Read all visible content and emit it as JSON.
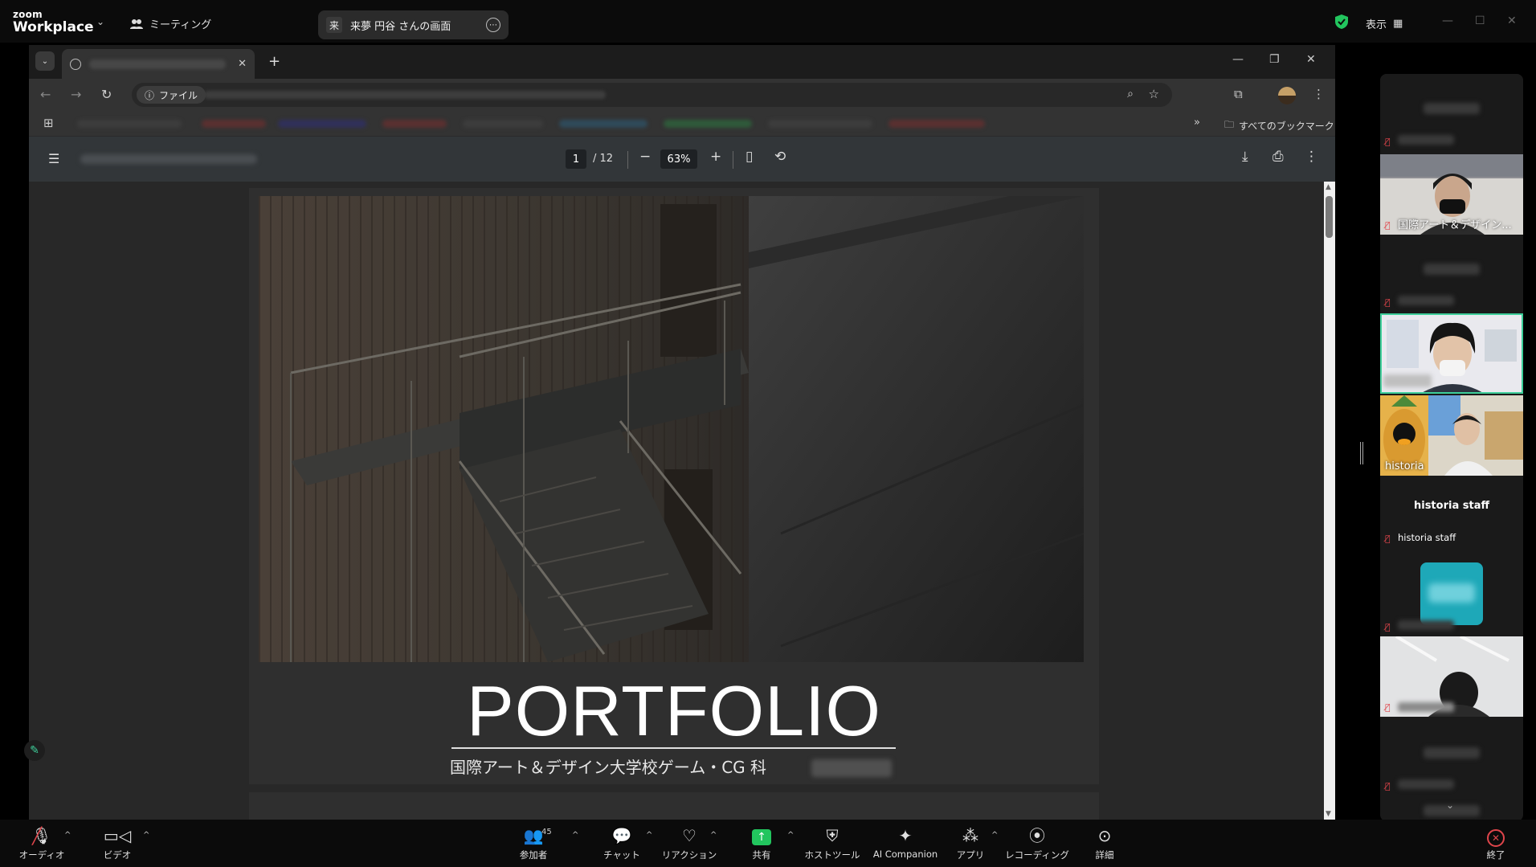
{
  "zoom": {
    "logo_small": "zoom",
    "logo_big": "Workplace",
    "meeting_label": "ミーティング",
    "share_badge": "来",
    "share_title": "来夢 円谷 さんの画面",
    "view_label": "表示"
  },
  "browser": {
    "omnibox_chip": "ファイル",
    "all_bookmarks": "すべてのブックマーク"
  },
  "pdf": {
    "current_page": "1",
    "total_pages": "/ 12",
    "zoom_level": "63%",
    "cover_title": "PORTFOLIO",
    "cover_subtitle": "国際アート＆デザイン大学校ゲーム・CG 科"
  },
  "gallery": {
    "tiles": [
      {
        "label": "国際アート＆デザイン..."
      },
      {
        "label": "historia"
      },
      {
        "title": "historia staff",
        "label": "historia staff"
      }
    ]
  },
  "controls": {
    "audio": "オーディオ",
    "video": "ビデオ",
    "participants": "参加者",
    "participants_count": "45",
    "chat": "チャット",
    "reactions": "リアクション",
    "share": "共有",
    "host_tools": "ホストツール",
    "ai_companion": "AI Companion",
    "apps": "アプリ",
    "recording": "レコーディング",
    "more": "詳細",
    "end": "終了"
  },
  "colors": {
    "accent_green": "#22c55e",
    "mute_red": "#e0454b",
    "active_speaker_border": "#3ecf9a"
  }
}
